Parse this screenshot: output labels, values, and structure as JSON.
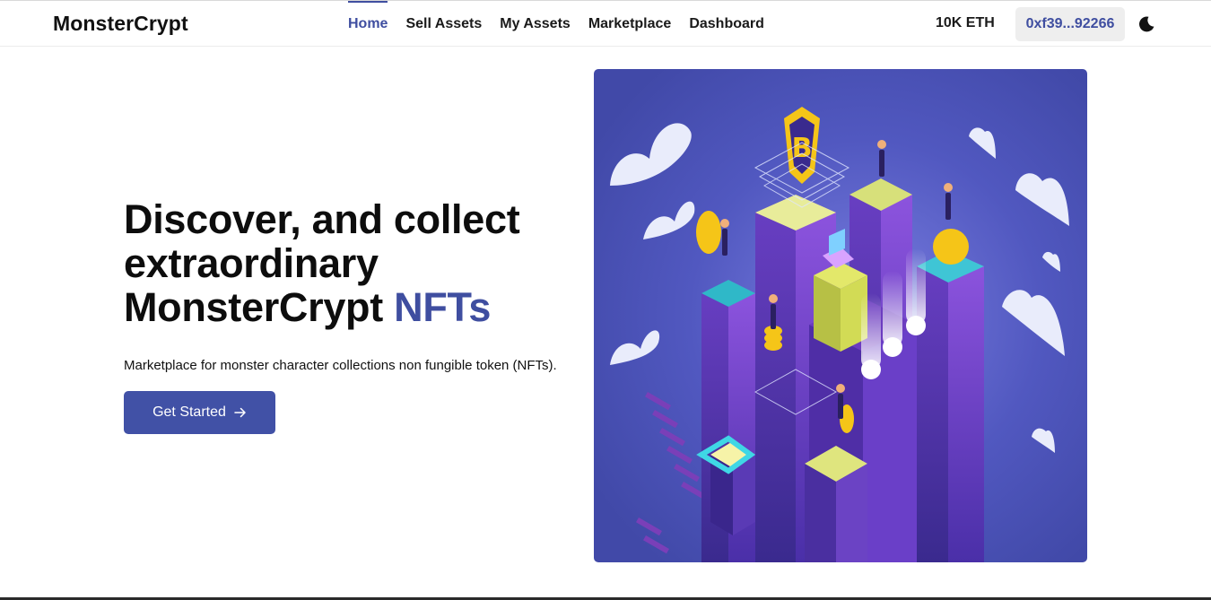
{
  "header": {
    "brand": "MonsterCrypt",
    "nav": [
      {
        "label": "Home",
        "active": true
      },
      {
        "label": "Sell Assets",
        "active": false
      },
      {
        "label": "My Assets",
        "active": false
      },
      {
        "label": "Marketplace",
        "active": false
      },
      {
        "label": "Dashboard",
        "active": false
      }
    ],
    "balance": "10K ETH",
    "wallet_address": "0xf39...92266",
    "theme_icon": "moon-icon"
  },
  "hero": {
    "title_line1": "Discover, and collect",
    "title_line2": "extraordinary",
    "title_line3": "MonsterCrypt",
    "title_accent": "NFTs",
    "subtitle": "Marketplace for monster character collections non fungible token (NFTs).",
    "cta_label": "Get Started",
    "cta_icon": "arrow-right-icon",
    "illustration": "isometric-crypto-city-illustration"
  },
  "colors": {
    "accent": "#3f4ea0",
    "button": "#4151a6",
    "wallet_bg": "#eeeeee",
    "illustration_bg": "#4b52b8"
  }
}
